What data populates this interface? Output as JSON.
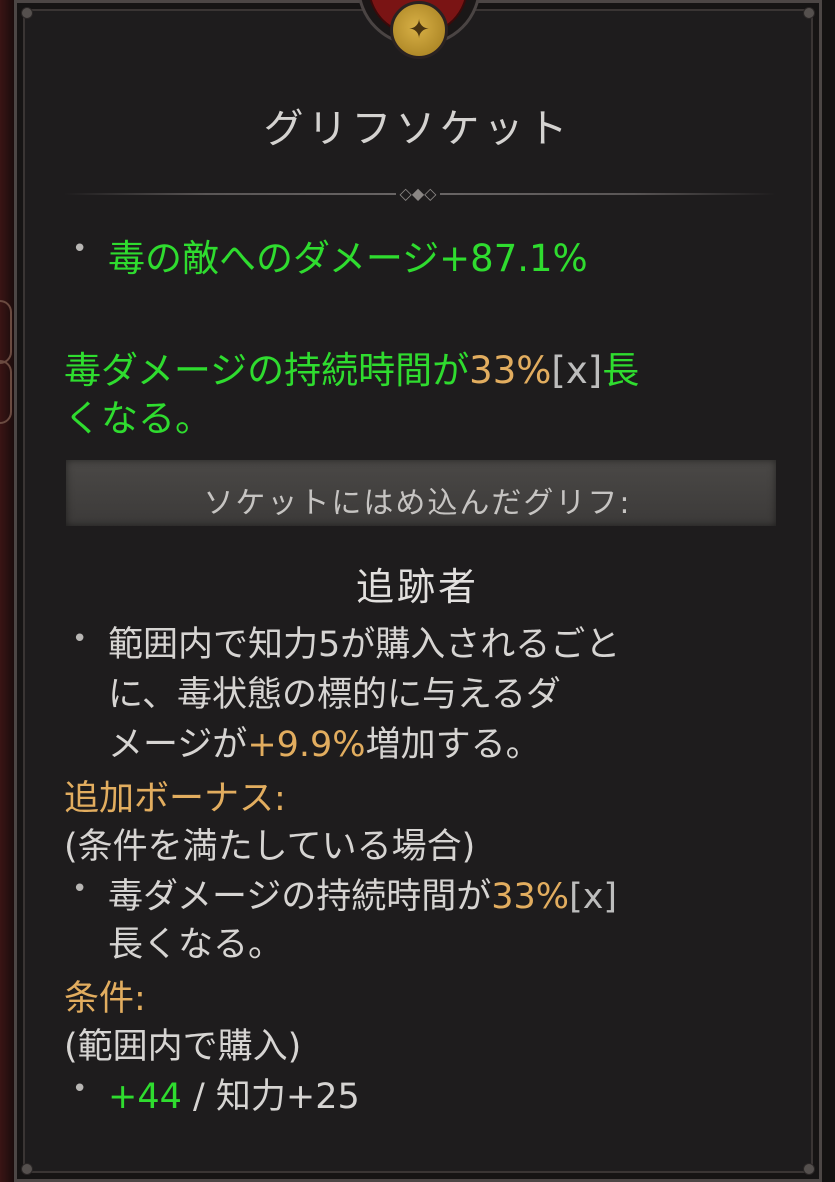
{
  "tooltip": {
    "title": "グリフソケット",
    "stat_line": "毒の敵へのダメージ+87.1%",
    "effect_text_1": "毒ダメージの持続時間が",
    "effect_value": "33%",
    "effect_x": "[x]",
    "effect_text_2": "長",
    "effect_text_3": "くなる。",
    "section_label": "ソケットにはめ込んだグリフ:",
    "glyph_name": "追跡者",
    "glyph_desc_1": "範囲内で知力5が購入されるごと",
    "glyph_desc_2": "に、毒状態の標的に与えるダ",
    "glyph_desc_3a": "メージが",
    "glyph_desc_value": "+9.9%",
    "glyph_desc_3b": "増加する。",
    "bonus_header": "追加ボーナス:",
    "bonus_condition": "(条件を満たしている場合)",
    "bonus_text_1": "毒ダメージの持続時間が",
    "bonus_value": "33%",
    "bonus_x": "[x]",
    "bonus_text_2": "長くなる。",
    "requirement_header": "条件:",
    "requirement_condition": "(範囲内で購入)",
    "requirement_current": "+44",
    "requirement_sep": " / ",
    "requirement_needed": "知力+25"
  },
  "colors": {
    "panel_bg": "#1e1c1d",
    "green": "#2fdc2f",
    "gold": "#e2ad5f",
    "grey": "#bdbdbd"
  },
  "icons": {
    "emblem": "glyph-emblem-icon",
    "bullet": "bullet-dot-icon",
    "divider": "diamond-divider-icon"
  }
}
